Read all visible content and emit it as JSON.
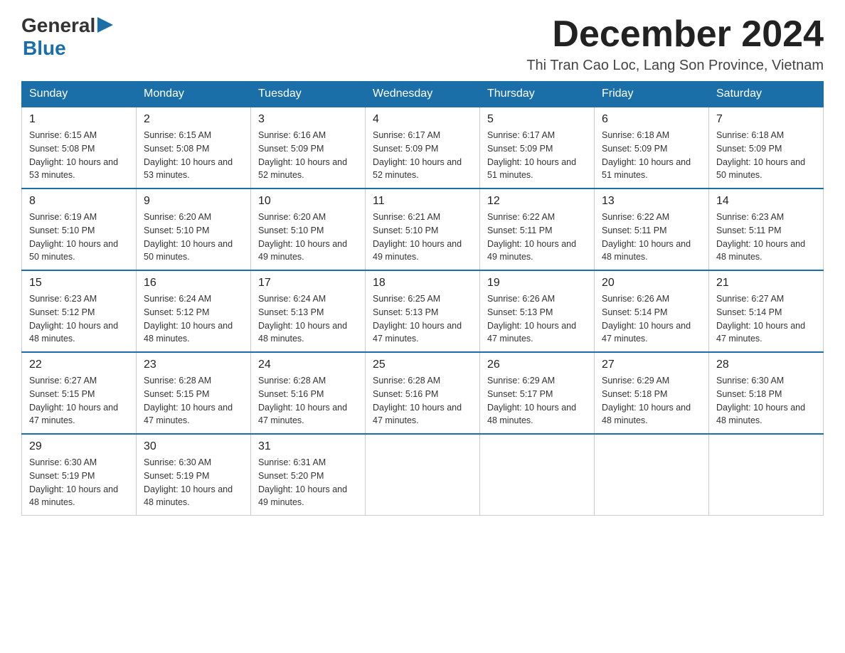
{
  "header": {
    "logo_general": "General",
    "logo_blue": "Blue",
    "month_title": "December 2024",
    "location": "Thi Tran Cao Loc, Lang Son Province, Vietnam"
  },
  "days_of_week": [
    "Sunday",
    "Monday",
    "Tuesday",
    "Wednesday",
    "Thursday",
    "Friday",
    "Saturday"
  ],
  "weeks": [
    [
      {
        "day": "1",
        "sunrise": "6:15 AM",
        "sunset": "5:08 PM",
        "daylight": "10 hours and 53 minutes."
      },
      {
        "day": "2",
        "sunrise": "6:15 AM",
        "sunset": "5:08 PM",
        "daylight": "10 hours and 53 minutes."
      },
      {
        "day": "3",
        "sunrise": "6:16 AM",
        "sunset": "5:09 PM",
        "daylight": "10 hours and 52 minutes."
      },
      {
        "day": "4",
        "sunrise": "6:17 AM",
        "sunset": "5:09 PM",
        "daylight": "10 hours and 52 minutes."
      },
      {
        "day": "5",
        "sunrise": "6:17 AM",
        "sunset": "5:09 PM",
        "daylight": "10 hours and 51 minutes."
      },
      {
        "day": "6",
        "sunrise": "6:18 AM",
        "sunset": "5:09 PM",
        "daylight": "10 hours and 51 minutes."
      },
      {
        "day": "7",
        "sunrise": "6:18 AM",
        "sunset": "5:09 PM",
        "daylight": "10 hours and 50 minutes."
      }
    ],
    [
      {
        "day": "8",
        "sunrise": "6:19 AM",
        "sunset": "5:10 PM",
        "daylight": "10 hours and 50 minutes."
      },
      {
        "day": "9",
        "sunrise": "6:20 AM",
        "sunset": "5:10 PM",
        "daylight": "10 hours and 50 minutes."
      },
      {
        "day": "10",
        "sunrise": "6:20 AM",
        "sunset": "5:10 PM",
        "daylight": "10 hours and 49 minutes."
      },
      {
        "day": "11",
        "sunrise": "6:21 AM",
        "sunset": "5:10 PM",
        "daylight": "10 hours and 49 minutes."
      },
      {
        "day": "12",
        "sunrise": "6:22 AM",
        "sunset": "5:11 PM",
        "daylight": "10 hours and 49 minutes."
      },
      {
        "day": "13",
        "sunrise": "6:22 AM",
        "sunset": "5:11 PM",
        "daylight": "10 hours and 48 minutes."
      },
      {
        "day": "14",
        "sunrise": "6:23 AM",
        "sunset": "5:11 PM",
        "daylight": "10 hours and 48 minutes."
      }
    ],
    [
      {
        "day": "15",
        "sunrise": "6:23 AM",
        "sunset": "5:12 PM",
        "daylight": "10 hours and 48 minutes."
      },
      {
        "day": "16",
        "sunrise": "6:24 AM",
        "sunset": "5:12 PM",
        "daylight": "10 hours and 48 minutes."
      },
      {
        "day": "17",
        "sunrise": "6:24 AM",
        "sunset": "5:13 PM",
        "daylight": "10 hours and 48 minutes."
      },
      {
        "day": "18",
        "sunrise": "6:25 AM",
        "sunset": "5:13 PM",
        "daylight": "10 hours and 47 minutes."
      },
      {
        "day": "19",
        "sunrise": "6:26 AM",
        "sunset": "5:13 PM",
        "daylight": "10 hours and 47 minutes."
      },
      {
        "day": "20",
        "sunrise": "6:26 AM",
        "sunset": "5:14 PM",
        "daylight": "10 hours and 47 minutes."
      },
      {
        "day": "21",
        "sunrise": "6:27 AM",
        "sunset": "5:14 PM",
        "daylight": "10 hours and 47 minutes."
      }
    ],
    [
      {
        "day": "22",
        "sunrise": "6:27 AM",
        "sunset": "5:15 PM",
        "daylight": "10 hours and 47 minutes."
      },
      {
        "day": "23",
        "sunrise": "6:28 AM",
        "sunset": "5:15 PM",
        "daylight": "10 hours and 47 minutes."
      },
      {
        "day": "24",
        "sunrise": "6:28 AM",
        "sunset": "5:16 PM",
        "daylight": "10 hours and 47 minutes."
      },
      {
        "day": "25",
        "sunrise": "6:28 AM",
        "sunset": "5:16 PM",
        "daylight": "10 hours and 47 minutes."
      },
      {
        "day": "26",
        "sunrise": "6:29 AM",
        "sunset": "5:17 PM",
        "daylight": "10 hours and 48 minutes."
      },
      {
        "day": "27",
        "sunrise": "6:29 AM",
        "sunset": "5:18 PM",
        "daylight": "10 hours and 48 minutes."
      },
      {
        "day": "28",
        "sunrise": "6:30 AM",
        "sunset": "5:18 PM",
        "daylight": "10 hours and 48 minutes."
      }
    ],
    [
      {
        "day": "29",
        "sunrise": "6:30 AM",
        "sunset": "5:19 PM",
        "daylight": "10 hours and 48 minutes."
      },
      {
        "day": "30",
        "sunrise": "6:30 AM",
        "sunset": "5:19 PM",
        "daylight": "10 hours and 48 minutes."
      },
      {
        "day": "31",
        "sunrise": "6:31 AM",
        "sunset": "5:20 PM",
        "daylight": "10 hours and 49 minutes."
      },
      null,
      null,
      null,
      null
    ]
  ]
}
